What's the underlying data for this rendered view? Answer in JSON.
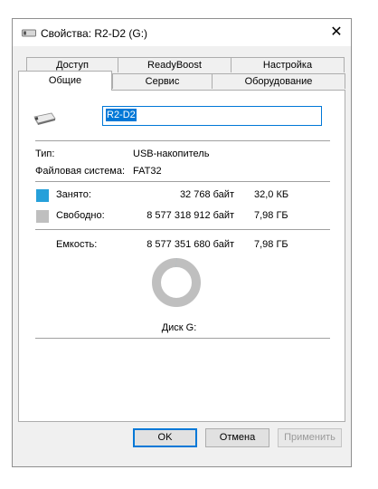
{
  "window": {
    "title": "Свойства: R2-D2 (G:)",
    "close_glyph": "✕"
  },
  "tabs": {
    "row_back": [
      "Доступ",
      "ReadyBoost",
      "Настройка"
    ],
    "row_front": [
      "Общие",
      "Сервис",
      "Оборудование"
    ],
    "active": "Общие"
  },
  "general": {
    "volume_name": "R2-D2",
    "type_label": "Тип:",
    "type_value": "USB-накопитель",
    "fs_label": "Файловая система:",
    "fs_value": "FAT32",
    "used_label": "Занято:",
    "used_bytes": "32 768 байт",
    "used_short": "32,0 КБ",
    "free_label": "Свободно:",
    "free_bytes": "8 577 318 912 байт",
    "free_short": "7,98 ГБ",
    "capacity_label": "Емкость:",
    "capacity_bytes": "8 577 351 680 байт",
    "capacity_short": "7,98 ГБ",
    "disk_label": "Диск G:",
    "used_fraction": 3.8e-06,
    "used_color": "#26a0da",
    "free_color": "#bfbfbf"
  },
  "buttons": {
    "ok": "OK",
    "cancel": "Отмена",
    "apply": "Применить"
  }
}
